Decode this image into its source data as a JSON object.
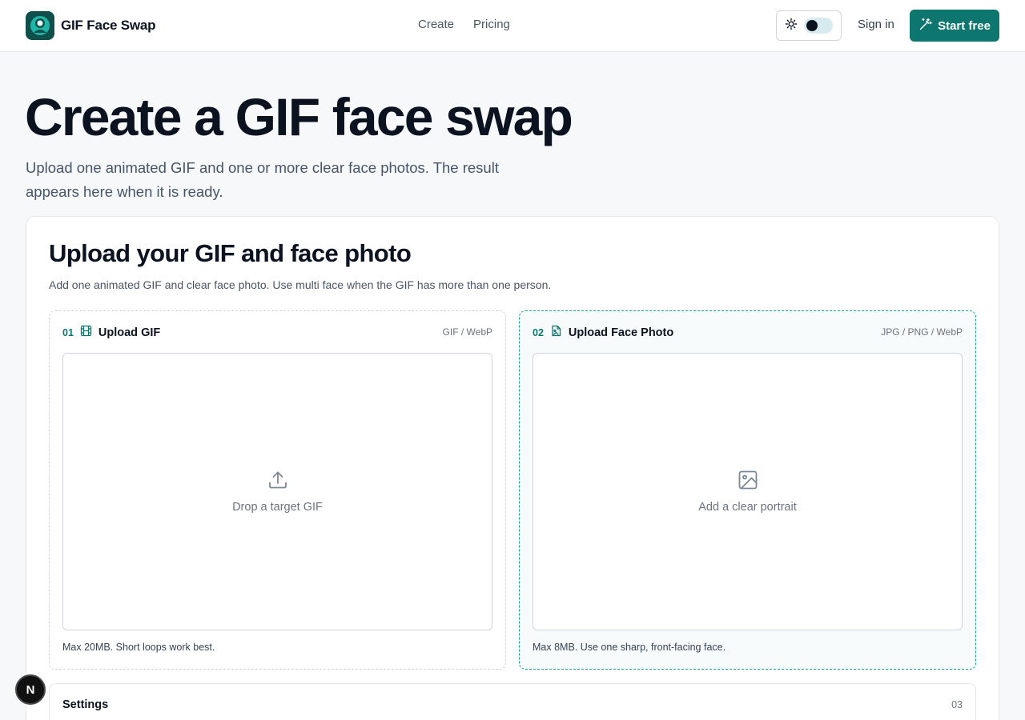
{
  "header": {
    "brand_name": "GIF Face Swap",
    "nav": [
      "Create",
      "Pricing"
    ],
    "sign_in": "Sign in",
    "start_free": "Start free"
  },
  "hero": {
    "title": "Create a GIF face swap",
    "subtitle": "Upload one animated GIF and one or more clear face photos. The result appears here when it is ready."
  },
  "upload_card": {
    "title": "Upload your GIF and face photo",
    "description": "Add one animated GIF and clear face photo. Use multi face when the GIF has more than one person.",
    "panels": [
      {
        "step": "01",
        "title": "Upload GIF",
        "formats": "GIF / WebP",
        "drop_text": "Drop a target GIF",
        "note": "Max 20MB. Short loops work best.",
        "icon": "film-icon"
      },
      {
        "step": "02",
        "title": "Upload Face Photo",
        "formats": "JPG / PNG / WebP",
        "drop_text": "Add a clear portrait",
        "note": "Max 8MB. Use one sharp, front-facing face.",
        "icon": "image-file-icon"
      }
    ],
    "settings": {
      "title": "Settings",
      "step": "03"
    }
  },
  "floating_badge": {
    "label": "N"
  },
  "colors": {
    "accent": "#0d766e",
    "accent_border": "#14a394",
    "text_dark": "#0b1220",
    "text_muted": "#6b7280"
  }
}
